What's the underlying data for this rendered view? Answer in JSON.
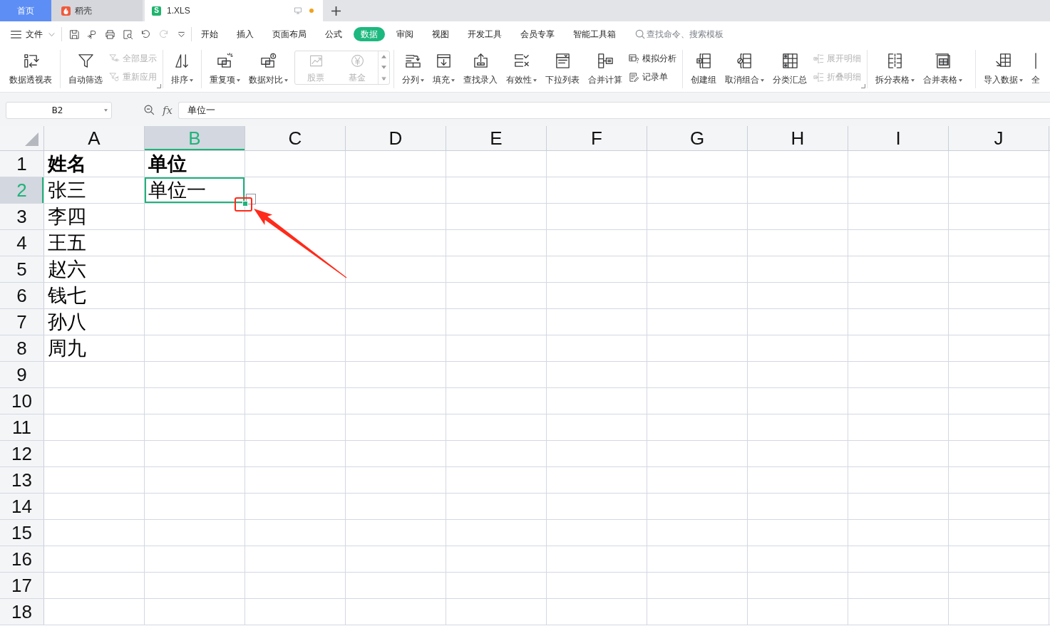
{
  "tabs": [
    {
      "label": "首页",
      "kind": "home",
      "selected": false
    },
    {
      "label": "稻壳",
      "kind": "docer",
      "selected": false
    },
    {
      "label": "1.XLS",
      "kind": "workbook",
      "badge": "S",
      "selected": true,
      "modified": true
    }
  ],
  "toolbar": {
    "file_menu": "文件",
    "quick_access": [
      {
        "disabled": false
      },
      {
        "disabled": false
      },
      {
        "disabled": false
      },
      {
        "disabled": false
      },
      {
        "disabled": false
      },
      {
        "disabled": true
      }
    ]
  },
  "menu_tabs": [
    {
      "label": "开始",
      "selected": false
    },
    {
      "label": "插入",
      "selected": false
    },
    {
      "label": "页面布局",
      "selected": false
    },
    {
      "label": "公式",
      "selected": false
    },
    {
      "label": "数据",
      "selected": true
    },
    {
      "label": "审阅",
      "selected": false
    },
    {
      "label": "视图",
      "selected": false
    },
    {
      "label": "开发工具",
      "selected": false
    },
    {
      "label": "会员专享",
      "selected": false
    },
    {
      "label": "智能工具箱",
      "selected": false
    }
  ],
  "search": {
    "placeholder": "查找命令、搜索模板"
  },
  "ribbon": [
    {
      "launcher": false,
      "columns": [
        {
          "kind": "large",
          "label": "数据透视表",
          "dropdown": false,
          "disabled": false
        }
      ]
    },
    {
      "launcher": true,
      "columns": [
        {
          "kind": "large",
          "label": "自动筛选",
          "dropdown": false,
          "disabled": false
        },
        {
          "kind": "stack",
          "items": [
            {
              "label": "全部显示",
              "disabled": true
            },
            {
              "label": "重新应用",
              "disabled": true
            }
          ]
        }
      ]
    },
    {
      "launcher": false,
      "columns": [
        {
          "kind": "large",
          "label": "排序",
          "dropdown": true,
          "disabled": false
        }
      ]
    },
    {
      "launcher": false,
      "columns": [
        {
          "kind": "large",
          "label": "重复项",
          "dropdown": true,
          "disabled": false
        },
        {
          "kind": "large",
          "label": "数据对比",
          "dropdown": true,
          "disabled": false
        },
        {
          "kind": "gallery",
          "items": [
            {
              "label": "股票",
              "disabled": true
            },
            {
              "label": "基金",
              "disabled": true
            }
          ]
        }
      ]
    },
    {
      "launcher": false,
      "columns": [
        {
          "kind": "large",
          "label": "分列",
          "dropdown": true,
          "disabled": false
        },
        {
          "kind": "large",
          "label": "填充",
          "dropdown": true,
          "disabled": false
        },
        {
          "kind": "large",
          "label": "查找录入",
          "dropdown": false,
          "disabled": false
        },
        {
          "kind": "large",
          "label": "有效性",
          "dropdown": true,
          "disabled": false
        },
        {
          "kind": "large",
          "label": "下拉列表",
          "dropdown": false,
          "disabled": false
        },
        {
          "kind": "large",
          "label": "合并计算",
          "dropdown": false,
          "disabled": false
        },
        {
          "kind": "stack",
          "items": [
            {
              "label": "模拟分析",
              "disabled": false
            },
            {
              "label": "记录单",
              "disabled": false
            }
          ]
        }
      ]
    },
    {
      "launcher": true,
      "columns": [
        {
          "kind": "large",
          "label": "创建组",
          "dropdown": false,
          "disabled": false
        },
        {
          "kind": "large",
          "label": "取消组合",
          "dropdown": true,
          "disabled": false
        },
        {
          "kind": "large",
          "label": "分类汇总",
          "dropdown": false,
          "disabled": false
        },
        {
          "kind": "stack",
          "items": [
            {
              "label": "展开明细",
              "disabled": true
            },
            {
              "label": "折叠明细",
              "disabled": true
            }
          ]
        }
      ]
    },
    {
      "launcher": false,
      "columns": [
        {
          "kind": "large",
          "label": "拆分表格",
          "dropdown": true,
          "disabled": false
        },
        {
          "kind": "large",
          "label": "合并表格",
          "dropdown": true,
          "disabled": false
        }
      ]
    },
    {
      "launcher": false,
      "columns": [
        {
          "kind": "large",
          "label": "导入数据",
          "dropdown": true,
          "disabled": false
        },
        {
          "kind": "large",
          "label": "全",
          "dropdown": false,
          "disabled": false
        }
      ]
    }
  ],
  "formula_bar": {
    "name_box": "B2",
    "function_label": "fx",
    "formula": "单位一"
  },
  "grid": {
    "columns": [
      {
        "label": "A",
        "selected": false
      },
      {
        "label": "B",
        "selected": true
      },
      {
        "label": "C",
        "selected": false
      },
      {
        "label": "D",
        "selected": false
      },
      {
        "label": "E",
        "selected": false
      },
      {
        "label": "F",
        "selected": false
      },
      {
        "label": "G",
        "selected": false
      },
      {
        "label": "H",
        "selected": false
      },
      {
        "label": "I",
        "selected": false
      },
      {
        "label": "J",
        "selected": false
      }
    ],
    "rows": [
      {
        "number": "1",
        "selected": false,
        "bold": true,
        "cells": [
          {
            "text": "姓名",
            "active": false
          },
          {
            "text": "单位",
            "active": false
          }
        ]
      },
      {
        "number": "2",
        "selected": true,
        "bold": false,
        "cells": [
          {
            "text": "张三",
            "active": false
          },
          {
            "text": "单位一",
            "active": true
          }
        ]
      },
      {
        "number": "3",
        "selected": false,
        "bold": false,
        "cells": [
          {
            "text": "李四",
            "active": false
          }
        ]
      },
      {
        "number": "4",
        "selected": false,
        "bold": false,
        "cells": [
          {
            "text": "王五",
            "active": false
          }
        ]
      },
      {
        "number": "5",
        "selected": false,
        "bold": false,
        "cells": [
          {
            "text": "赵六",
            "active": false
          }
        ]
      },
      {
        "number": "6",
        "selected": false,
        "bold": false,
        "cells": [
          {
            "text": "钱七",
            "active": false
          }
        ]
      },
      {
        "number": "7",
        "selected": false,
        "bold": false,
        "cells": [
          {
            "text": "孙八",
            "active": false
          }
        ]
      },
      {
        "number": "8",
        "selected": false,
        "bold": false,
        "cells": [
          {
            "text": "周九",
            "active": false
          }
        ]
      },
      {
        "number": "9",
        "selected": false
      },
      {
        "number": "10",
        "selected": false
      },
      {
        "number": "11",
        "selected": false
      },
      {
        "number": "12",
        "selected": false
      },
      {
        "number": "13",
        "selected": false
      },
      {
        "number": "14",
        "selected": false
      },
      {
        "number": "15",
        "selected": false
      },
      {
        "number": "16",
        "selected": false
      },
      {
        "number": "17",
        "selected": false
      },
      {
        "number": "18",
        "selected": false
      }
    ]
  }
}
